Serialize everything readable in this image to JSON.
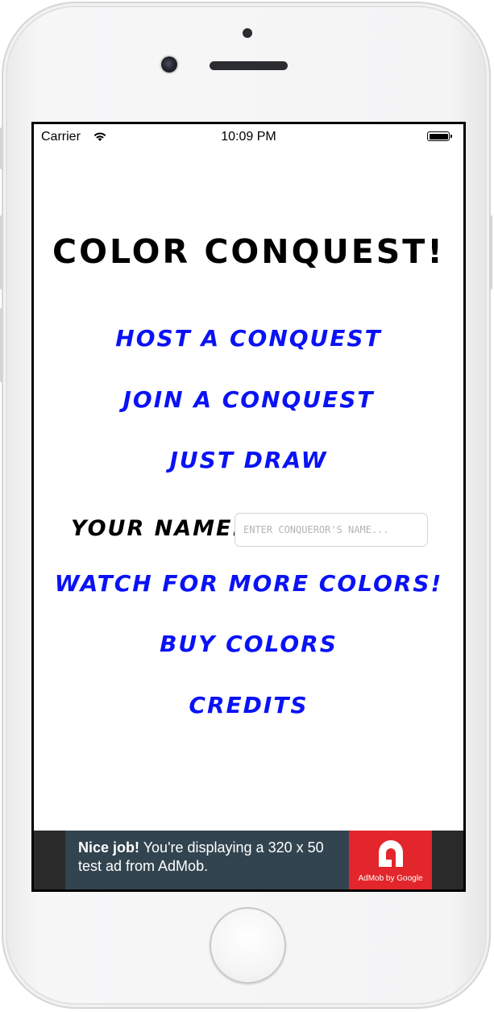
{
  "status_bar": {
    "carrier": "Carrier",
    "time": "10:09 PM"
  },
  "app": {
    "title": "COLOR CONQUEST!",
    "menu": [
      {
        "id": "host",
        "label": "HOST A CONQUEST"
      },
      {
        "id": "join",
        "label": "JOIN A CONQUEST"
      },
      {
        "id": "draw",
        "label": "JUST DRAW"
      }
    ],
    "name_label": "YOUR NAME:",
    "name_input": {
      "value": "",
      "placeholder": "ENTER CONQUEROR'S NAME..."
    },
    "extra_menu": [
      {
        "id": "watch",
        "label": "WATCH FOR MORE COLORS!"
      },
      {
        "id": "buy",
        "label": "BUY COLORS"
      },
      {
        "id": "credits",
        "label": "CREDITS"
      }
    ]
  },
  "ad": {
    "headline": "Nice job!",
    "body": " You're displaying a 320 x 50 test ad from AdMob.",
    "logo_caption": "AdMob by Google"
  },
  "colors": {
    "menu_text": "#0a12f5",
    "title_text": "#000000",
    "ad_background": "#32444f",
    "ad_logo": "#e2262b"
  }
}
